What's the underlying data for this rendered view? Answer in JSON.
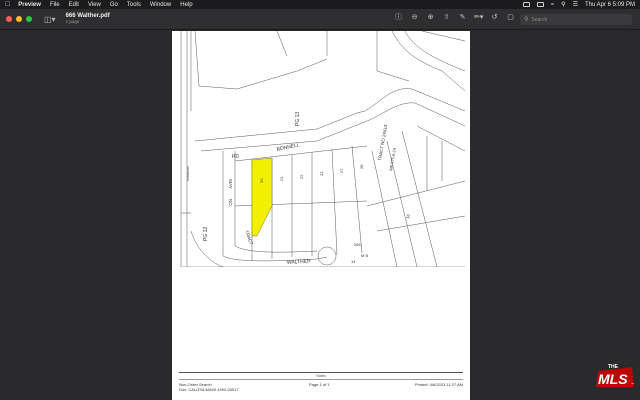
{
  "menubar": {
    "app": "Preview",
    "items": [
      "File",
      "Edit",
      "View",
      "Go",
      "Tools",
      "Window",
      "Help"
    ],
    "clock": "Thu Apr 6  5:09 PM"
  },
  "window": {
    "title": "666 Walther.pdf",
    "subtitle": "1 page",
    "search_placeholder": "Search"
  },
  "map": {
    "labels": {
      "bonnell": "BONNELL",
      "rd": "RD",
      "way": "WAY",
      "no": "NO",
      "tract_left": "TRACT",
      "walther": "WALTHER",
      "tract_right": "TRACT NO 24413",
      "mb": "MB 675-6-24",
      "pg13": "PG 13",
      "pg12": "PG 12",
      "sanborn": "SANBORN",
      "lot265": "265",
      "lot14": "14",
      "lot16": "16",
      "lot20": "20",
      "lot21": "21",
      "lot22": "22",
      "lot23": "23",
      "lot27": "27",
      "lot28": "28",
      "mb_small": "M B"
    }
  },
  "footer": {
    "notes": "Notes",
    "search_type": "Non-Order Search",
    "doc": "Doc: CALOSA:MA00 4494-00017",
    "page": "Page 1 of 1",
    "printed": "Printed:   4/6/2023 11:27 AM"
  },
  "logo": {
    "the": "THE",
    "mls": "MLS",
    "tm": "™"
  }
}
